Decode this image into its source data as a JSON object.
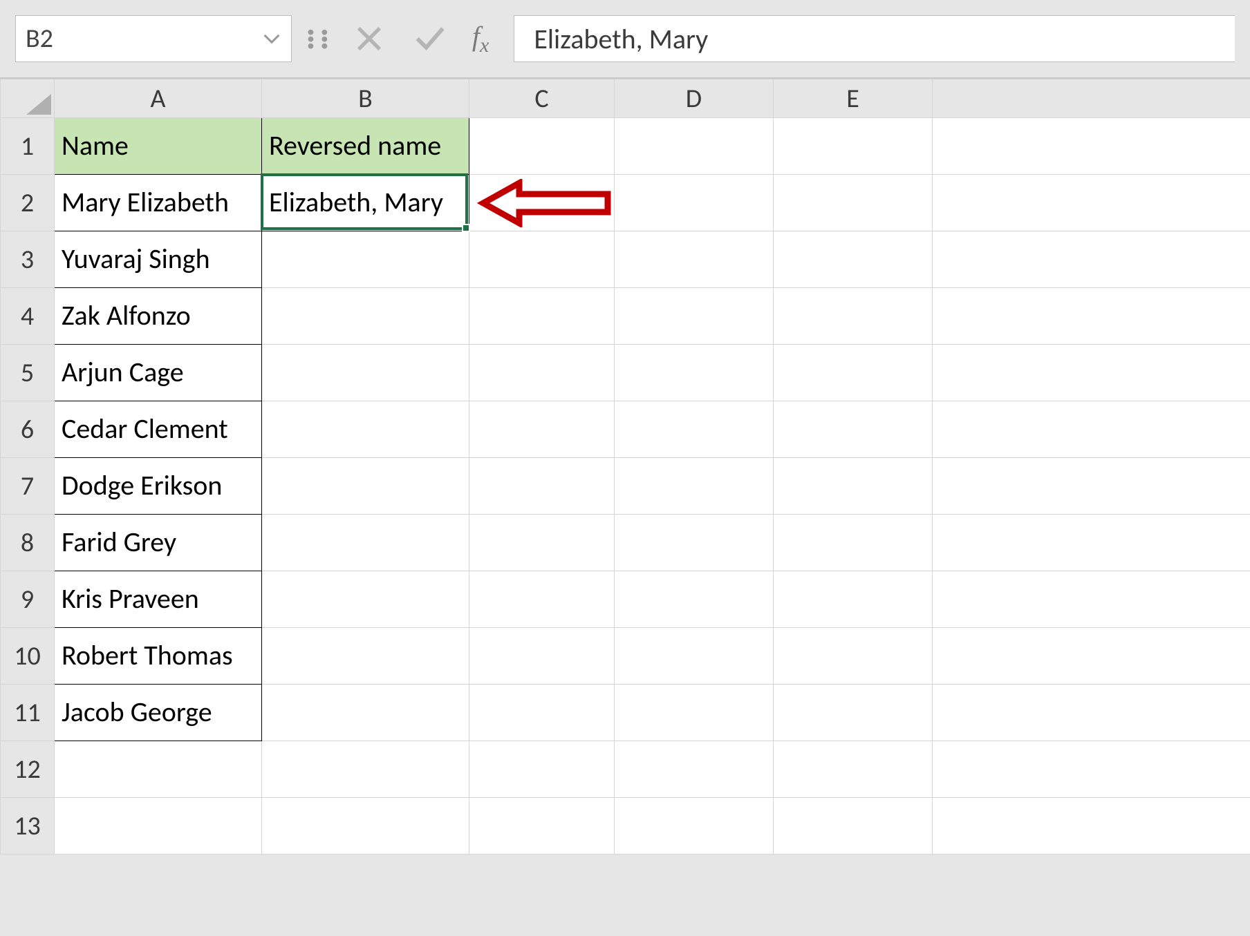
{
  "name_box": {
    "value": "B2"
  },
  "formula_bar": {
    "value": "Elizabeth, Mary"
  },
  "columns": [
    "A",
    "B",
    "C",
    "D",
    "E"
  ],
  "row_numbers": [
    1,
    2,
    3,
    4,
    5,
    6,
    7,
    8,
    9,
    10,
    11,
    12,
    13
  ],
  "headers": {
    "A": "Name",
    "B": "Reversed name"
  },
  "data": {
    "A": [
      "Mary Elizabeth",
      "Yuvaraj Singh",
      "Zak Alfonzo",
      "Arjun Cage",
      "Cedar Clement",
      "Dodge Erikson",
      "Farid Grey",
      "Kris Praveen",
      "Robert Thomas",
      "Jacob George"
    ],
    "B": [
      "Elizabeth, Mary"
    ]
  },
  "active_cell": {
    "ref": "B2",
    "row": 2,
    "col": "B"
  },
  "colors": {
    "header_fill": "#c6e5b3",
    "selection": "#1e7145",
    "arrow": "#c00000"
  }
}
